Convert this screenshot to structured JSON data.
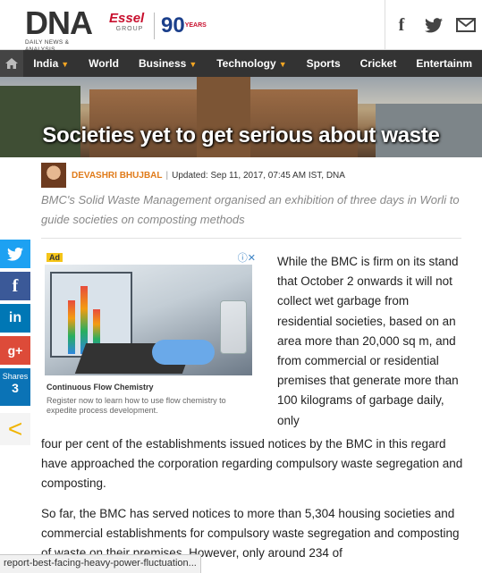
{
  "header": {
    "logo_big": "DNA",
    "logo_small": "DAILY NEWS & ANALYSIS",
    "essel_logo": "Essel",
    "essel_group": "GROUP",
    "anniversary": "90",
    "anniversary_sub": "YEARS",
    "social": [
      {
        "icon": "facebook-icon",
        "glyph": "f"
      },
      {
        "icon": "twitter-icon",
        "glyph": "🐦"
      },
      {
        "icon": "mail-icon",
        "glyph": "✉"
      }
    ]
  },
  "nav": {
    "home_icon": "home-icon",
    "items": [
      {
        "label": "India",
        "dropdown": true
      },
      {
        "label": "World",
        "dropdown": false
      },
      {
        "label": "Business",
        "dropdown": true
      },
      {
        "label": "Technology",
        "dropdown": true
      },
      {
        "label": "Sports",
        "dropdown": false
      },
      {
        "label": "Cricket",
        "dropdown": false
      },
      {
        "label": "Entertainm",
        "dropdown": false
      }
    ],
    "caret": "▼"
  },
  "article": {
    "title": "Societies yet to get serious about waste",
    "author": "DEVASHRI BHUJBAL",
    "updated": "Updated: Sep 11, 2017, 07:45 AM IST, DNA",
    "summary": "BMC's Solid Waste Management organised an exhibition of three days in Worli to guide societies on composting methods",
    "para1_col": "While the BMC is firm on its stand that October 2 onwards it will not collect wet garbage from residential societies, based on an area more than 20,000 sq m, and from commercial or residential premises that generate more than 100 kilograms of garbage daily, only",
    "para1_full": "four per cent of the establishments issued notices by the BMC in this regard have approached the corporation regarding compulsory waste segregation and composting.",
    "para2": "So far, the BMC has served notices to more than 5,304 housing societies and commercial establishments for compulsory waste segregation and composting of waste on their premises. However, only around 234 of"
  },
  "share": {
    "twitter": "🐦",
    "facebook": "f",
    "linkedin": "in",
    "googleplus": "g+",
    "shares_label": "Shares",
    "shares_count": "3",
    "back_glyph": "<"
  },
  "ad": {
    "tag": "Ad",
    "title": "Continuous Flow Chemistry",
    "description": "Register now to learn how to use flow chemistry to expedite process development."
  },
  "status_bar": {
    "url": "report-best-facing-heavy-power-fluctuation..."
  }
}
